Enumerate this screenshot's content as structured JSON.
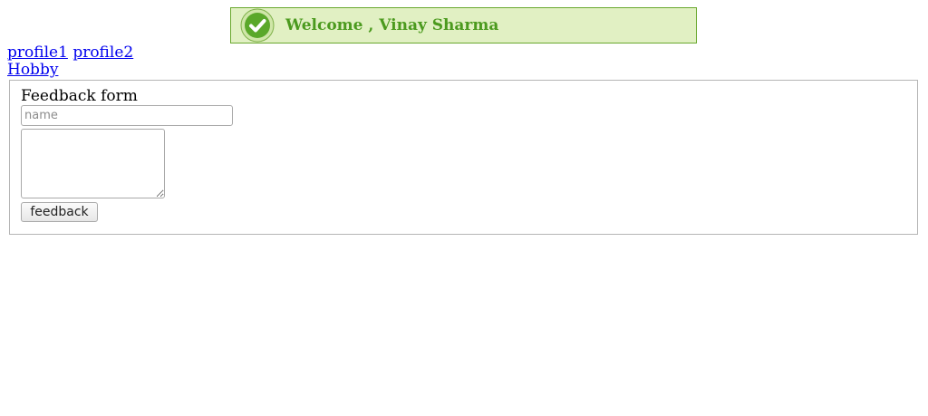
{
  "banner": {
    "icon": "check-circle-icon",
    "message": "Welcome , Vinay Sharma",
    "colors": {
      "background": "#e1f0c3",
      "border": "#6aa82f",
      "text": "#4b9a1e",
      "icon": "#5aa82a"
    }
  },
  "nav": {
    "links": [
      "profile1",
      "profile2",
      "Hobby"
    ]
  },
  "feedback_form": {
    "title": "Feedback form",
    "name_input": {
      "value": "",
      "placeholder": "name"
    },
    "textarea": {
      "value": ""
    },
    "submit_label": "feedback"
  }
}
